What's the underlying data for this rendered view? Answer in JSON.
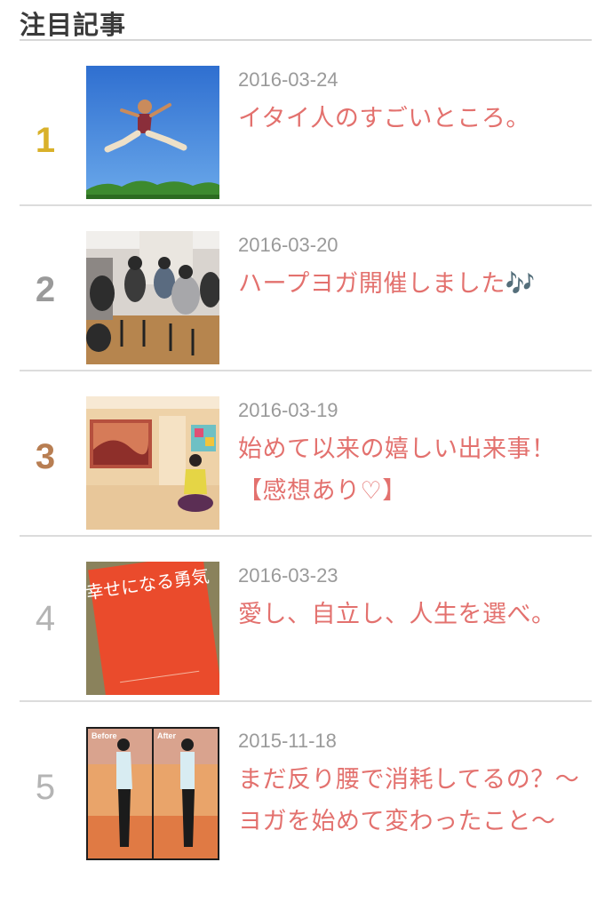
{
  "section": {
    "title": "注目記事"
  },
  "entries": [
    {
      "rank": "1",
      "date": "2016-03-24",
      "title": "イタイ人のすごいところ。",
      "thumb_icon": "jumping-person-sky-photo"
    },
    {
      "rank": "2",
      "date": "2016-03-20",
      "title": "ハープヨガ開催しました🎶",
      "thumb_icon": "yoga-class-chairs-photo"
    },
    {
      "rank": "3",
      "date": "2016-03-19",
      "title": "始めて以来の嬉しい出来事！【感想あり♡】",
      "thumb_icon": "yoga-studio-photo"
    },
    {
      "rank": "4",
      "date": "2016-03-23",
      "title": "愛し、自立し、人生を選べ。",
      "thumb_icon": "book-cover-photo",
      "thumb_text": "幸せになる勇気"
    },
    {
      "rank": "5",
      "date": "2015-11-18",
      "title": "まだ反り腰で消耗してるの？〜ヨガを始めて変わったこと〜",
      "thumb_icon": "before-after-posture-photo",
      "thumb_labels": [
        "Before",
        "After"
      ]
    }
  ]
}
